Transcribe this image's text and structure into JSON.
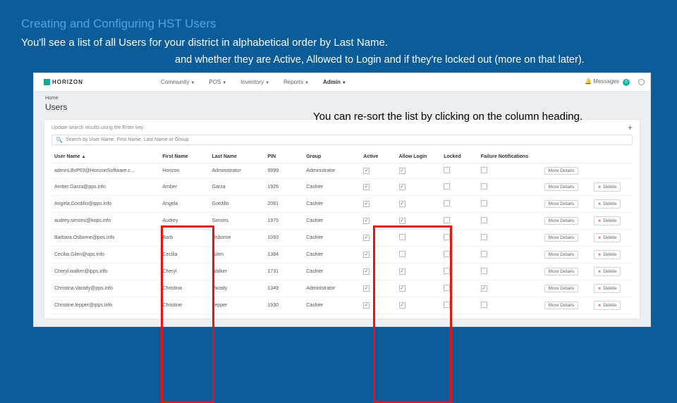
{
  "slide": {
    "title": "Creating and Configuring HST Users",
    "sub1": "You'll see a list of all Users for your district in alphabetical order by Last Name.",
    "sub2": "and whether they are Active, Allowed to Login and if they're locked out (more on that later).",
    "resort_callout": "You can re-sort the list by clicking on the column heading."
  },
  "topnav": {
    "brand": "HORIZON",
    "items": [
      "Community",
      "POS",
      "Inventory",
      "Reports",
      "Admin"
    ],
    "active_idx": 4,
    "messages_label": "Messages",
    "messages_badge": "0"
  },
  "page": {
    "crumb": "Home",
    "title": "Users"
  },
  "panel": {
    "hint": "Update search results using the Enter key.",
    "search_placeholder": "Search by User Name, First Name, Last Name or Group",
    "plus": "+"
  },
  "columns": {
    "user_name": "User Name",
    "first_name": "First Name",
    "last_name": "Last Name",
    "pin": "PIN",
    "group": "Group",
    "active": "Active",
    "allow_login": "Allow Login",
    "locked": "Locked",
    "failure_notifications": "Failure Notifications",
    "sort_indicator": "▲"
  },
  "buttons": {
    "more_details": "More Details",
    "delete": "Delete"
  },
  "rows": [
    {
      "user": "adminLBvP03@HorizonSoftware.c…",
      "first": "Horizon",
      "last": "Administrator",
      "pin": "9999",
      "group": "Administrator",
      "active": true,
      "login": true,
      "locked": false,
      "fail": false,
      "deletable": false
    },
    {
      "user": "Amber.Garza@pps.info",
      "first": "Amber",
      "last": "Garza",
      "pin": "1926",
      "group": "Cashier",
      "active": true,
      "login": true,
      "locked": false,
      "fail": false,
      "deletable": true
    },
    {
      "user": "Angela.Gordillo@ipps.info",
      "first": "Angela",
      "last": "Gordillo",
      "pin": "2081",
      "group": "Cashier",
      "active": true,
      "login": true,
      "locked": false,
      "fail": false,
      "deletable": true
    },
    {
      "user": "audrey.simons@kops.info",
      "first": "Audrey",
      "last": "Simons",
      "pin": "1975",
      "group": "Cashier",
      "active": true,
      "login": true,
      "locked": false,
      "fail": false,
      "deletable": true
    },
    {
      "user": "Barbara.Osborne@pos.info",
      "first": "Barb",
      "last": "Osborne",
      "pin": "1093",
      "group": "Cashier",
      "active": true,
      "login": false,
      "locked": false,
      "fail": false,
      "deletable": true
    },
    {
      "user": "Cecilia.Gilen@ops.info",
      "first": "Cecilia",
      "last": "Gilen",
      "pin": "1384",
      "group": "Cashier",
      "active": true,
      "login": false,
      "locked": false,
      "fail": false,
      "deletable": true
    },
    {
      "user": "Cheryl.walker@ipps.info",
      "first": "Cheryl",
      "last": "Walker",
      "pin": "1731",
      "group": "Cashier",
      "active": true,
      "login": true,
      "locked": false,
      "fail": false,
      "deletable": true
    },
    {
      "user": "Christina.Varady@pps.info",
      "first": "Christina",
      "last": "Varady",
      "pin": "1349",
      "group": "Administrator",
      "active": true,
      "login": true,
      "locked": false,
      "fail": true,
      "deletable": true
    },
    {
      "user": "Christine.lepper@ipps.info",
      "first": "Christine",
      "last": "Lepper",
      "pin": "1930",
      "group": "Cashier",
      "active": true,
      "login": true,
      "locked": false,
      "fail": false,
      "deletable": true
    }
  ]
}
